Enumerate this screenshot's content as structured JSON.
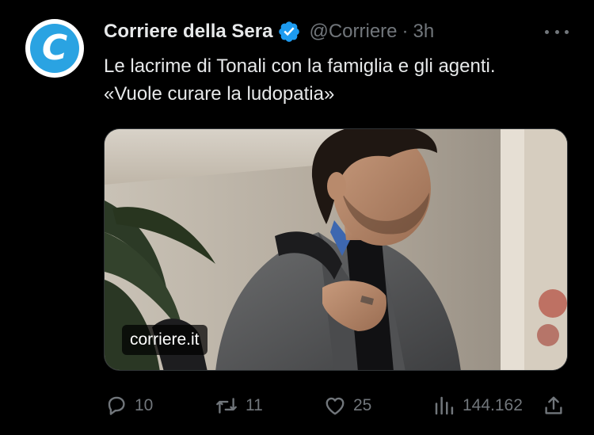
{
  "tweet": {
    "display_name": "Corriere della Sera",
    "handle": "@Corriere",
    "separator": "·",
    "time": "3h",
    "avatar_letter": "C",
    "text_lines": [
      "Le lacrime di Tonali con la famiglia e gli agenti.",
      "«Vuole curare la ludopatia»"
    ],
    "link_domain": "corriere.it"
  },
  "actions": {
    "replies": "10",
    "reposts": "11",
    "likes": "25",
    "views": "144.162"
  },
  "colors": {
    "background": "#000000",
    "text": "#e7e9ea",
    "secondary": "#71767b",
    "verified": "#1d9bf0",
    "avatar": "#2aa3e2"
  },
  "icons": {
    "verified": "verified-badge-icon",
    "more": "more-dots-icon",
    "reply": "reply-bubble-icon",
    "repost": "repost-arrows-icon",
    "like": "heart-icon",
    "views": "bar-chart-icon",
    "share": "share-upload-icon"
  }
}
